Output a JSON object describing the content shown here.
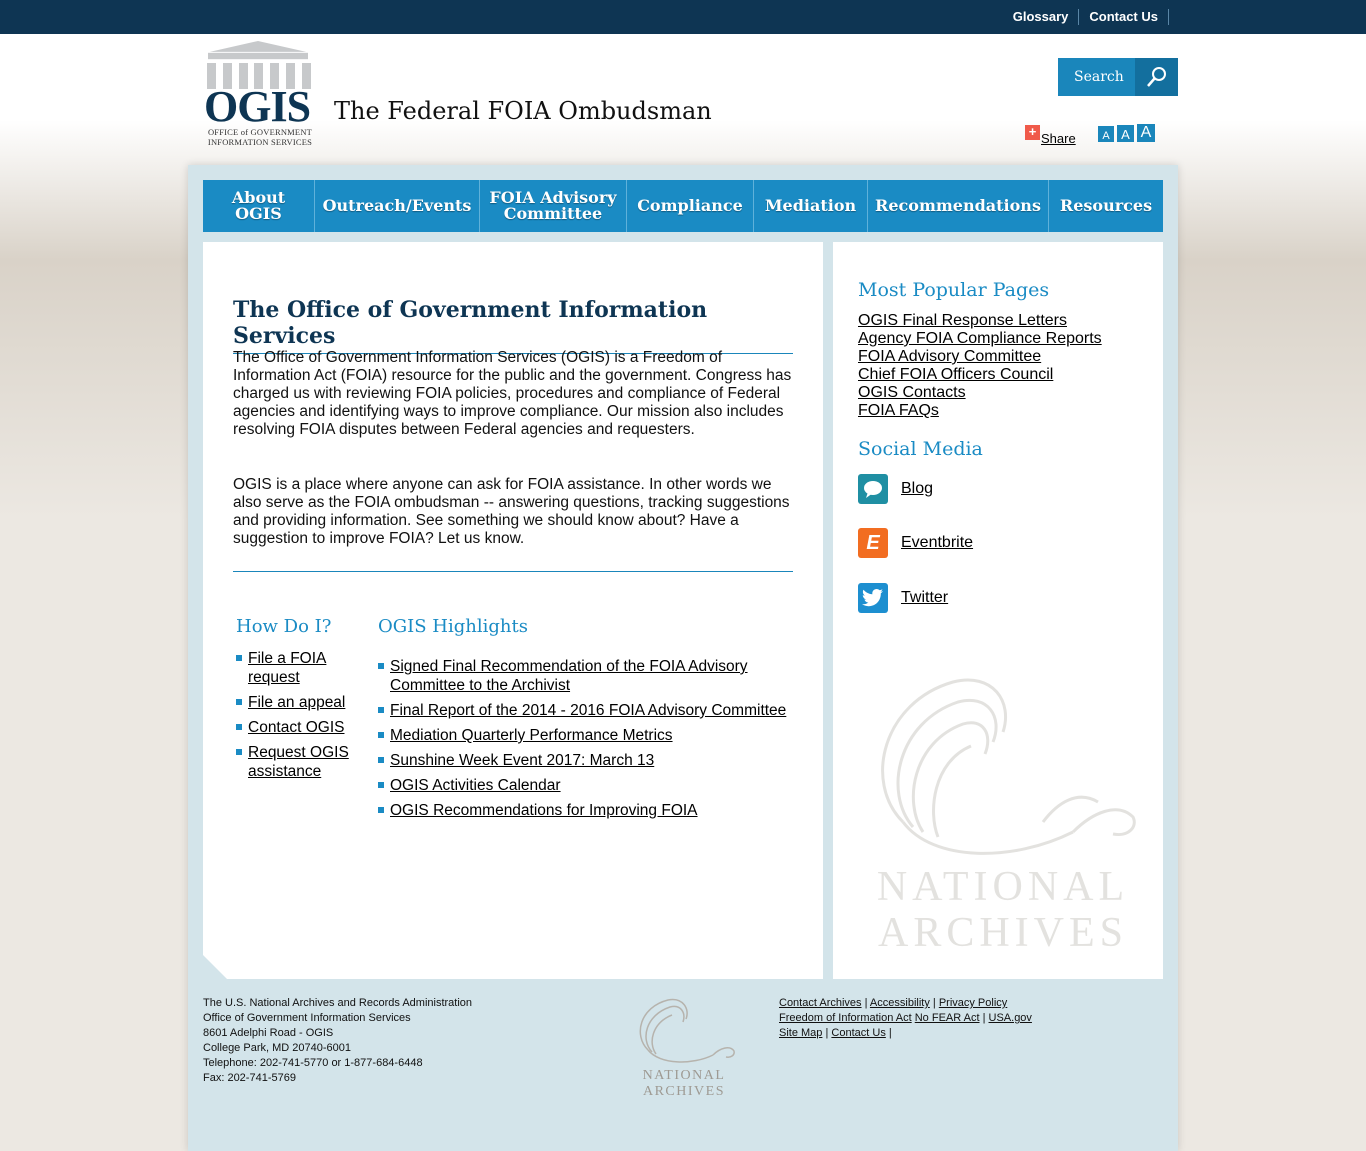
{
  "topbar": {
    "links": [
      "Glossary",
      "Contact Us"
    ]
  },
  "logo": {
    "wordmark": "OGIS",
    "subtitle_line1": "OFFICE of GOVERNMENT",
    "subtitle_line2": "INFORMATION SERVICES"
  },
  "header": {
    "site_title": "The Federal FOIA Ombudsman",
    "search_label": "Search",
    "share_label": "Share",
    "font_sizes": [
      "A",
      "A",
      "A"
    ]
  },
  "nav": {
    "items": [
      {
        "line1": "About",
        "line2": "OGIS"
      },
      {
        "line1": "Outreach/Events",
        "line2": ""
      },
      {
        "line1": "FOIA Advisory",
        "line2": "Committee"
      },
      {
        "line1": "Compliance",
        "line2": ""
      },
      {
        "line1": "Mediation",
        "line2": ""
      },
      {
        "line1": "Recommendations",
        "line2": ""
      },
      {
        "line1": "Resources",
        "line2": ""
      }
    ]
  },
  "main": {
    "title": "The Office of Government Information Services",
    "para1": "The Office of Government Information Services (OGIS) is a Freedom of Information Act (FOIA) resource for the public and the government. Congress has charged us with reviewing FOIA policies, procedures and compliance of Federal agencies and identifying ways to improve compliance. Our mission also includes resolving FOIA disputes between Federal agencies and requesters.",
    "para2": "OGIS is a place where anyone can ask for FOIA assistance. In other words we also serve as the FOIA ombudsman -- answering questions, tracking suggestions and providing information. See something we should know about? Have a suggestion to improve FOIA? Let us know.",
    "howdo_title": "How Do I?",
    "howdo_items": [
      "File a FOIA request",
      "File an appeal",
      "Contact OGIS",
      "Request OGIS assistance"
    ],
    "highlights_title": "OGIS Highlights",
    "highlights_items": [
      "Signed Final Recommendation of the FOIA Advisory Committee to the Archivist",
      "Final Report of the 2014 - 2016 FOIA Advisory Committee",
      "Mediation Quarterly Performance Metrics",
      "Sunshine Week Event 2017: March 13",
      "OGIS Activities Calendar",
      "OGIS Recommendations for Improving FOIA"
    ]
  },
  "sidebar": {
    "popular_title": "Most Popular Pages",
    "popular_items": [
      "OGIS Final Response Letters",
      "Agency FOIA Compliance Reports",
      "FOIA Advisory Committee",
      "Chief FOIA Officers Council",
      "OGIS Contacts",
      "FOIA FAQs"
    ],
    "social_title": "Social Media",
    "social_items": [
      {
        "label": "Blog",
        "icon": "blog-icon",
        "color": "#1f8fa3"
      },
      {
        "label": "Eventbrite",
        "icon": "eventbrite-icon",
        "color": "#f26d21"
      },
      {
        "label": "Twitter",
        "icon": "twitter-icon",
        "color": "#1d8fd0"
      }
    ],
    "watermark_line1": "NATIONAL",
    "watermark_line2": "ARCHIVES"
  },
  "footer": {
    "address": [
      "The U.S. National Archives and Records Administration",
      "Office of Government Information Services",
      "8601 Adelphi Road - OGIS",
      "College Park, MD 20740-6001",
      "Telephone: 202-741-5770 or 1-877-684-6448",
      "Fax: 202-741-5769"
    ],
    "links": {
      "contact_us": "Contact Archives",
      "accessibility": "Accessibility",
      "privacy": "Privacy Policy",
      "foia": "Freedom of Information Act",
      "nofear": "No FEAR Act",
      "usagov": "USA.gov",
      "sitemap": "Site Map",
      "contact": "Contact Us"
    },
    "logo_line1": "NATIONAL",
    "logo_line2": "ARCHIVES"
  },
  "colors": {
    "navy": "#0e3553",
    "accent": "#1a8bc4",
    "frame": "#d3e4ea"
  }
}
